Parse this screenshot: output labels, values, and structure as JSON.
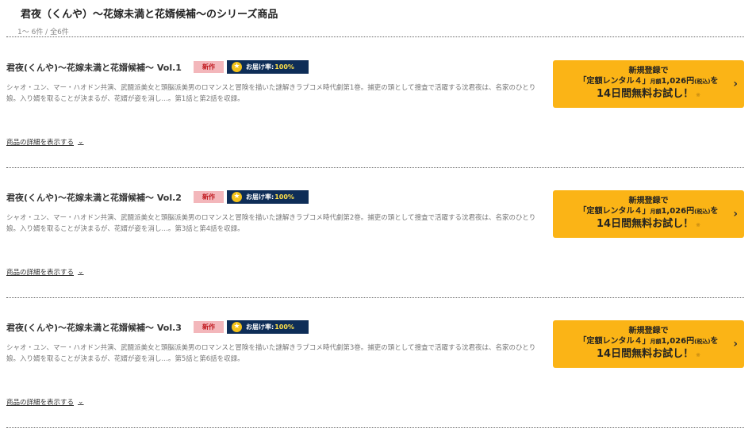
{
  "header": {
    "title": "君夜（くんや）～花嫁未満と花婿候補～のシリーズ商品",
    "count": "1～ 6件 / 全6件"
  },
  "items": [
    {
      "title": "君夜(くんや)～花嫁未満と花婿候補～ Vol.1",
      "badge_new": "新作",
      "rate_label": "お届け率:",
      "rate_value": "100%",
      "description": "シャオ・ユン、マー・ハオドン共演、武闘派美女と頭脳派美男のロマンスと冒険を描いた謎解きラブコメ時代劇第1巻。捕吏の頭として捜査で活躍する沈君夜は、名家のひとり娘。入り婿を取ることが決まるが、花婿が姿を消し…。第1話と第2話を収録。",
      "details_link": "商品の詳細を表示する"
    },
    {
      "title": "君夜(くんや)～花嫁未満と花婿候補～ Vol.2",
      "badge_new": "新作",
      "rate_label": "お届け率:",
      "rate_value": "100%",
      "description": "シャオ・ユン、マー・ハオドン共演、武闘派美女と頭脳派美男のロマンスと冒険を描いた謎解きラブコメ時代劇第2巻。捕吏の頭として捜査で活躍する沈君夜は、名家のひとり娘。入り婿を取ることが決まるが、花婿が姿を消し…。第3話と第4話を収録。",
      "details_link": "商品の詳細を表示する"
    },
    {
      "title": "君夜(くんや)～花嫁未満と花婿候補～ Vol.3",
      "badge_new": "新作",
      "rate_label": "お届け率:",
      "rate_value": "100%",
      "description": "シャオ・ユン、マー・ハオドン共演、武闘派美女と頭脳派美男のロマンスと冒険を描いた謎解きラブコメ時代劇第3巻。捕吏の頭として捜査で活躍する沈君夜は、名家のひとり娘。入り婿を取ることが決まるが、花婿が姿を消し…。第5話と第6話を収録。",
      "details_link": "商品の詳細を表示する"
    }
  ],
  "cta": {
    "line1": "新規登録で",
    "line2_a": "「定額レンタル４」",
    "line2_small_a": "月額",
    "line2_b": "1,026円",
    "line2_small_b": "(税込)",
    "line2_c": "を",
    "line3": "14日間無料お試し！",
    "note": "※"
  },
  "icons": {
    "star": "star-icon",
    "chevron_down": "chevron-down-icon",
    "chevron_right": "chevron-right-icon"
  },
  "colors": {
    "cta_bg": "#fbb416",
    "rate_badge_bg": "#0e2d57",
    "new_badge_bg": "#f3b7bb",
    "new_badge_text": "#c0181e"
  }
}
